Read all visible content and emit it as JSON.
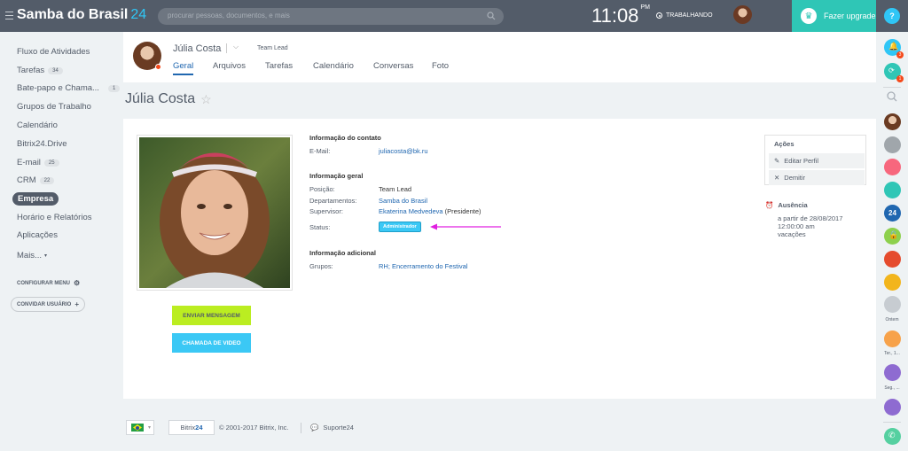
{
  "header": {
    "logo_name": "Samba do Brasil",
    "logo_number": "24",
    "search_placeholder": "procurar pessoas, documentos, e mais",
    "clock": "11:08",
    "clock_suffix": "PM",
    "work_status": "TRABALHANDO",
    "upgrade_label": "Fazer upgrade",
    "help_label": "?"
  },
  "sidebar": {
    "items": [
      {
        "label": "Fluxo de Atividades"
      },
      {
        "label": "Tarefas",
        "count": "34"
      },
      {
        "label": "Bate-papo e Chama...",
        "count": "1"
      },
      {
        "label": "Grupos de Trabalho"
      },
      {
        "label": "Calendário"
      },
      {
        "label": "Bitrix24.Drive"
      },
      {
        "label": "E-mail",
        "count": "25"
      },
      {
        "label": "CRM",
        "count": "22"
      },
      {
        "label": "Empresa"
      },
      {
        "label": "Horário e Relatórios"
      },
      {
        "label": "Aplicações"
      },
      {
        "label": "Mais..."
      }
    ],
    "configure_menu": "CONFIGURAR MENU",
    "invite_user": "CONVIDAR USUÁRIO"
  },
  "profile_header": {
    "name": "Júlia Costa",
    "position": "Team Lead",
    "tabs": [
      "Geral",
      "Arquivos",
      "Tarefas",
      "Calendário",
      "Conversas",
      "Foto"
    ]
  },
  "page_title": "Júlia Costa",
  "buttons": {
    "message": "ENVIAR MENSAGEM",
    "video_call": "CHAMADA DE VIDEO"
  },
  "contact": {
    "heading": "Informação do contato",
    "email_label": "E-Mail:",
    "email_value": "juliacosta@bk.ru"
  },
  "general": {
    "heading": "Informação geral",
    "position_label": "Posição:",
    "position_value": "Team Lead",
    "departments_label": "Departamentos:",
    "departments_value": "Samba do Brasil",
    "supervisor_label": "Supervisor:",
    "supervisor_value": "Ekaterina Medvedeva",
    "supervisor_role": "(Presidente)",
    "status_label": "Status:",
    "status_value": "Administrador"
  },
  "additional": {
    "heading": "Informação adicional",
    "groups_label": "Grupos:",
    "groups_value": "RH; Encerramento do Festival"
  },
  "actions": {
    "heading": "Ações",
    "edit": "Editar Perfil",
    "dismiss": "Demitir"
  },
  "absence": {
    "heading": "Ausência",
    "line1": "a partir de 28/08/2017",
    "line2": "12:00:00 am",
    "line3": "vacações"
  },
  "footer": {
    "logo_a": "Bitrix",
    "logo_b": "24",
    "copyright": "© 2001-2017 Bitrix, Inc.",
    "support": "Suporte24"
  },
  "right_bar": {
    "badge_notifications": "3",
    "badge_chats": "1",
    "label_ontem": "Ontem",
    "label_ter": "Ter., 1...",
    "label_seg": "Seg., ...",
    "app_24": "24"
  },
  "colors": {
    "topbar": "#535c69",
    "accent_blue": "#2fc6f6",
    "upgrade": "#2fc6b6",
    "message_button": "#bbed21",
    "video_button": "#3bc8f5",
    "link": "#2067b0",
    "annotation_arrow": "#e020e0"
  }
}
